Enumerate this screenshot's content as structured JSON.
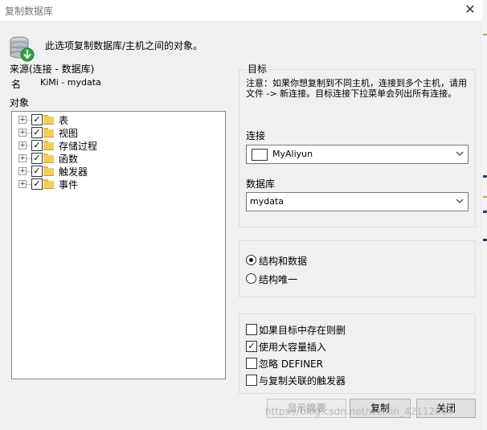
{
  "window": {
    "title": "复制数据库",
    "close_glyph": "✕"
  },
  "header": {
    "text": "此选项复制数据库/主机之间的对象。",
    "icon": "database-download-icon"
  },
  "source": {
    "label": "来源(连接 - 数据库)",
    "name_label": "名",
    "name_value": "KiMi - mydata",
    "objects_label": "对象",
    "objects": [
      {
        "label": "表",
        "checked": true
      },
      {
        "label": "视图",
        "checked": true
      },
      {
        "label": "存储过程",
        "checked": true
      },
      {
        "label": "函数",
        "checked": true
      },
      {
        "label": "触发器",
        "checked": true
      },
      {
        "label": "事件",
        "checked": true
      }
    ]
  },
  "target": {
    "label": "目标",
    "note": "注意：如果你想复制到不同主机，连接到多个主机，请用文件 -> 新连接。目标连接下拉菜单会列出所有连接。",
    "connection_label": "连接",
    "connection_value": "MyAliyun",
    "database_label": "数据库",
    "database_value": "mydata"
  },
  "mode": {
    "options": [
      {
        "label": "结构和数据",
        "selected": true
      },
      {
        "label": "结构唯一",
        "selected": false
      }
    ]
  },
  "options": [
    {
      "label": "如果目标中存在则删",
      "checked": false
    },
    {
      "label": "使用大容量插入",
      "checked": true
    },
    {
      "label": "忽略 DEFINER",
      "checked": false
    },
    {
      "label": "与复制关联的触发器",
      "checked": false
    }
  ],
  "buttons": {
    "summary": "显示摘要",
    "copy": "复制",
    "close": "关闭"
  },
  "watermark": "https://blog.csdn.net/weixin_42112064"
}
